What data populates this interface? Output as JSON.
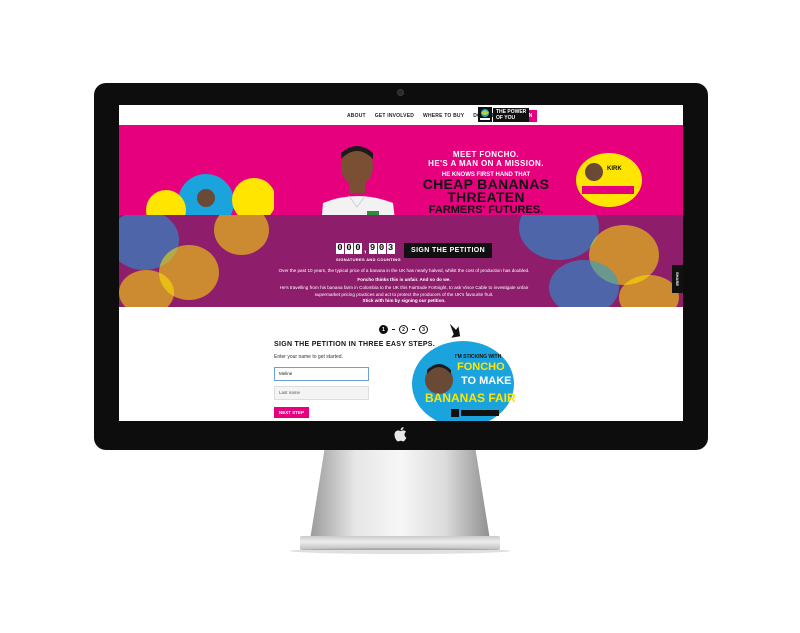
{
  "nav": {
    "items": [
      "ABOUT",
      "GET INVOLVED",
      "WHERE TO BUY",
      "DONATE"
    ],
    "petition": "PETITION",
    "power_of_you": [
      "THE POWER",
      "OF YOU"
    ]
  },
  "hero": {
    "meet": "MEET FONCHO.",
    "mission": "HE'S A MAN ON A MISSION.",
    "knows": "HE KNOWS FIRST HAND THAT",
    "cheap": "CHEAP BANANAS",
    "threaten": "THREATEN",
    "futures": "FARMERS' FUTURES."
  },
  "counter": {
    "digits": [
      "0",
      "0",
      "0",
      "9",
      "0",
      "3"
    ],
    "label": "SIGNATURES AND COUNTING",
    "sign_button": "SIGN THE PETITION"
  },
  "copy": {
    "p1": "Over the past 10 years, the typical price of a banana in the UK has nearly halved, whilst the cost of production has doubled.",
    "p2": "Foncho thinks this is unfair. And so do we.",
    "p3": "He's travelling from his banana farm in Colombia to the UK this Fairtrade Fortnight, to ask Vince Cable to investigate unfair supermarket pricing practices and act to protect the producers of the UK's favourite fruit.",
    "p4": "Stick with him by signing our petition."
  },
  "share": "SHARE",
  "steps": [
    "1",
    "2",
    "3"
  ],
  "form": {
    "title": "SIGN THE PETITION IN THREE EASY STEPS.",
    "hint": "Enter your name to get started.",
    "first_name_value": "Melinė",
    "last_name_placeholder": "Last name",
    "next_button": "NEXT STEP"
  },
  "sticker": {
    "line1": "I'M STICKING WITH",
    "line2": "FONCHO",
    "line3": "TO MAKE",
    "line4": "BANANAS FAIR",
    "small_kirk": "KIRK"
  },
  "colors": {
    "brand_pink": "#e6007e",
    "band_purple": "#8e1d6c",
    "sticker_blue": "#1aa3dd",
    "sticker_yellow": "#ffe500"
  }
}
